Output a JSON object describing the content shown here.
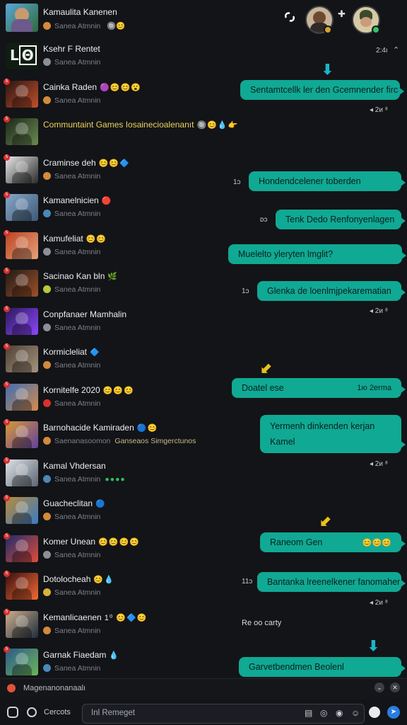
{
  "header": {
    "title": "Kamaulita Kanenen",
    "subtitle": "Sanea Atmnin",
    "time": "2:4ı",
    "link_icon": "link-icon",
    "plus_icon": "plus-icon"
  },
  "rows": [
    {
      "name": "Ksehr F Rentet",
      "emoji": "",
      "sub": "Sanea Atmnin",
      "thumb": [
        "#0f1d12",
        "#7fc9a2"
      ],
      "ico": "#8c8f98"
    },
    {
      "name": "Cainka Raden",
      "emoji": "🟣😊😊😮",
      "sub": "Sanea Atmnin",
      "thumb": [
        "#2a1512",
        "#c04f2c"
      ],
      "ico": "#d38a3b"
    },
    {
      "name": "Communtaint Games Iosainecioalenanıt",
      "emoji": "🔘😊💧👉",
      "sub": "",
      "thumb": [
        "#1b2718",
        "#6a8a52"
      ],
      "ico": "#8c8f98",
      "yellow": true
    },
    {
      "name": "Craminse deh",
      "emoji": "😊😊🔷",
      "sub": "Sanea Atmnin",
      "thumb": [
        "#e8e8ea",
        "#2b2b2b"
      ],
      "ico": "#d38a3b"
    },
    {
      "name": "Kamanelnicien",
      "emoji": "🔴",
      "sub": "Sanea Atmnin",
      "thumb": [
        "#87a7c9",
        "#3d5a77"
      ],
      "ico": "#4b88b8"
    },
    {
      "name": "Kamufeliat",
      "emoji": "😊😊",
      "sub": "Sanea Atmnin",
      "thumb": [
        "#bb4422",
        "#e4a27c"
      ],
      "ico": "#8c8f98"
    },
    {
      "name": "Sacinao Kan bln",
      "emoji": "🌿",
      "sub": "Sanea Atmnin",
      "thumb": [
        "#1e1a16",
        "#a0502a"
      ],
      "ico": "#b9c83a"
    },
    {
      "name": "Conpfanaer Mamhalin",
      "emoji": "",
      "sub": "Sanea Atmnin",
      "thumb": [
        "#2a1958",
        "#8d46ff"
      ],
      "ico": "#8c8f98"
    },
    {
      "name": "Kormicleliat",
      "emoji": "🔷",
      "sub": "Sanea Atmnin",
      "thumb": [
        "#4e4035",
        "#a5957e"
      ],
      "ico": "#d38a3b"
    },
    {
      "name": "Kornitelfe 2020",
      "emoji": "😊😊😊",
      "sub": "Sanea Atmnin",
      "thumb": [
        "#3e6fb3",
        "#d58a4c"
      ],
      "ico": "#d8302f"
    },
    {
      "name": "Barnohacide Kamiraden",
      "emoji": "🔵😊",
      "sub": "Saenanasoomon",
      "extra": "Ganseaos Simgerctunos",
      "thumb": [
        "#d79a34",
        "#6440a0"
      ],
      "ico": "#d38a3b"
    },
    {
      "name": "Kamal Vhdersan",
      "emoji": "",
      "sub": "Sanea Atmnin",
      "greens": "●●●●",
      "thumb": [
        "#dfe4ea",
        "#5c6570"
      ],
      "ico": "#4b88b8"
    },
    {
      "name": "Guacheclitan",
      "emoji": "🔵",
      "sub": "Sanea Atmnin",
      "thumb": [
        "#b88a3a",
        "#3a7cc4"
      ],
      "ico": "#d38a3b"
    },
    {
      "name": "Komer Unean",
      "emoji": "😊😊😊😊",
      "sub": "Sanea Atmnin",
      "thumb": [
        "#1d2c6b",
        "#e24c3a"
      ],
      "ico": "#8c8f98"
    },
    {
      "name": "Dotolocheah",
      "emoji": "😊💧",
      "sub": "Sanea Atmnin",
      "thumb": [
        "#3a0f0f",
        "#f06a34"
      ],
      "ico": "#d6b33c"
    },
    {
      "name": "Kemanlicaenen",
      "emoji": "1⁰ 😊🔷😊",
      "sub": "Sanea Atmnin",
      "thumb": [
        "#d0ae8c",
        "#1d2d3d"
      ],
      "ico": "#d38a3b"
    },
    {
      "name": "Garnak Fiaedam",
      "emoji": "💧",
      "sub": "Sanea Atmnin",
      "thumb": [
        "#2c5a8a",
        "#6cb35a"
      ],
      "ico": "#4b88b8"
    }
  ],
  "messages": [
    {
      "text": "Sentamtcellk ler den Gcemnender fircait",
      "tm": ""
    },
    {
      "text": "Hondendcelener toberden",
      "tm": ""
    },
    {
      "text": "Tenk Dedo Renfonyenlagen",
      "tm": ""
    },
    {
      "text": "Muelelto yleryten lmglit?",
      "tm": ""
    },
    {
      "text": "Glenka de loenlmjpekarematian",
      "tm": ""
    },
    {
      "text": "Doatel ese",
      "tm": "1ю 2erma"
    },
    {
      "text": "Yermenh dinkenden kerjan",
      "text2": "Kamel",
      "tm": ""
    },
    {
      "text": "Raneom Gen",
      "tm": "😊😊😊"
    },
    {
      "text": "Bantanka lreenelkener fanomahen",
      "tm": ""
    },
    {
      "text": "Garvetbendmen Beolenl",
      "tm": ""
    }
  ],
  "timestamps": {
    "t1": "◂ 2ᴎ ⁸",
    "t2": "◂ 2ᴎ ⁸",
    "t3": "◂ 2ᴎ ⁸",
    "t4": "◂ 2ᴎ ⁸"
  },
  "side_numbers": [
    "1ᴐ",
    "ᴅᴐ",
    "1ᴐ",
    "11ᴐ"
  ],
  "plain_message": "Re oo carty",
  "strip": {
    "label": "Magenanonanaalı"
  },
  "compose": {
    "tab_label": "Cercots",
    "placeholder": "Inl Remeget"
  },
  "colors": {
    "accent": "#10a994",
    "bg": "#131417",
    "badge": "#d8302f"
  }
}
